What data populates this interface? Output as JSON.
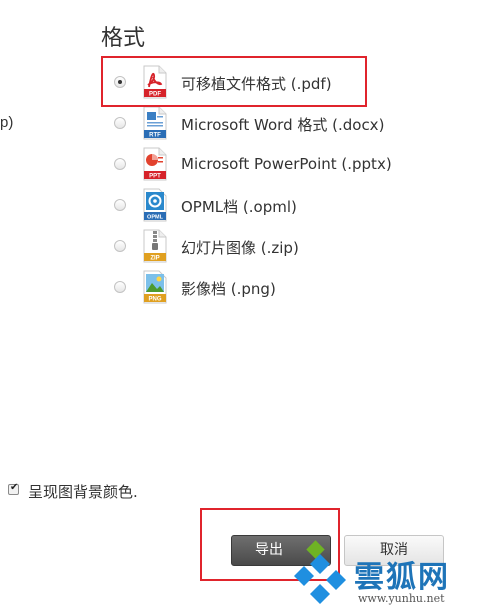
{
  "dialog": {
    "left_cut_text": "p)",
    "section_title": "格式",
    "formats": [
      {
        "label": "可移植文件格式 (.pdf)",
        "icon": "pdf-file-icon",
        "icon_tag": "PDF",
        "selected": true
      },
      {
        "label": "Microsoft Word 格式 (.docx)",
        "icon": "rtf-file-icon",
        "icon_tag": "RTF",
        "selected": false
      },
      {
        "label": "Microsoft PowerPoint (.pptx)",
        "icon": "ppt-file-icon",
        "icon_tag": "PPT",
        "selected": false
      },
      {
        "label": "OPML档 (.opml)",
        "icon": "opml-file-icon",
        "icon_tag": "OPML",
        "selected": false
      },
      {
        "label": "幻灯片图像 (.zip)",
        "icon": "zip-file-icon",
        "icon_tag": "ZIP",
        "selected": false
      },
      {
        "label": "影像档 (.png)",
        "icon": "png-file-icon",
        "icon_tag": "PNG",
        "selected": false
      }
    ],
    "background_color_option": {
      "label": "呈现图背景颜色.",
      "checked": true
    },
    "buttons": {
      "export_label": "导出",
      "cancel_label": "取消"
    }
  },
  "watermark": {
    "brand": "雲狐网",
    "url": "www.yunhu.net"
  },
  "colors": {
    "highlight_border": "#e0242c",
    "export_bg": "#555555",
    "export_accent": "#6fb324",
    "watermark_blue": "#1e74b8"
  }
}
